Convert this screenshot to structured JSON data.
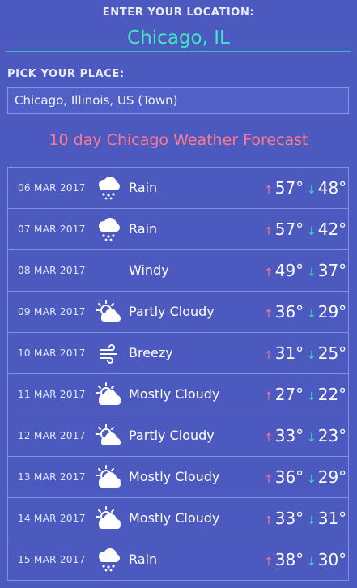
{
  "location_section": {
    "label": "ENTER YOUR LOCATION:",
    "value": "Chicago, IL"
  },
  "place_section": {
    "label": "PICK YOUR PLACE:",
    "selected": "Chicago, Illinois, US (Town)"
  },
  "forecast": {
    "title": "10 day Chicago Weather Forecast",
    "high_arrow": "↑",
    "low_arrow": "↓",
    "days": [
      {
        "date": "06 MAR 2017",
        "icon": "rain-icon",
        "condition": "Rain",
        "high": "57°",
        "low": "48°"
      },
      {
        "date": "07 MAR 2017",
        "icon": "rain-icon",
        "condition": "Rain",
        "high": "57°",
        "low": "42°"
      },
      {
        "date": "08 MAR 2017",
        "icon": "none",
        "condition": "Windy",
        "high": "49°",
        "low": "37°"
      },
      {
        "date": "09 MAR 2017",
        "icon": "partly-cloudy-icon",
        "condition": "Partly Cloudy",
        "high": "36°",
        "low": "29°"
      },
      {
        "date": "10 MAR 2017",
        "icon": "breezy-icon",
        "condition": "Breezy",
        "high": "31°",
        "low": "25°"
      },
      {
        "date": "11 MAR 2017",
        "icon": "mostly-cloudy-icon",
        "condition": "Mostly Cloudy",
        "high": "27°",
        "low": "22°"
      },
      {
        "date": "12 MAR 2017",
        "icon": "partly-cloudy-icon",
        "condition": "Partly Cloudy",
        "high": "33°",
        "low": "23°"
      },
      {
        "date": "13 MAR 2017",
        "icon": "mostly-cloudy-icon",
        "condition": "Mostly Cloudy",
        "high": "36°",
        "low": "29°"
      },
      {
        "date": "14 MAR 2017",
        "icon": "mostly-cloudy-icon",
        "condition": "Mostly Cloudy",
        "high": "33°",
        "low": "31°"
      },
      {
        "date": "15 MAR 2017",
        "icon": "rain-icon",
        "condition": "Rain",
        "high": "38°",
        "low": "30°"
      }
    ]
  },
  "colors": {
    "background": "#4c5abf",
    "accent_teal": "#41e6c5",
    "accent_pink": "#ff7a8e"
  }
}
